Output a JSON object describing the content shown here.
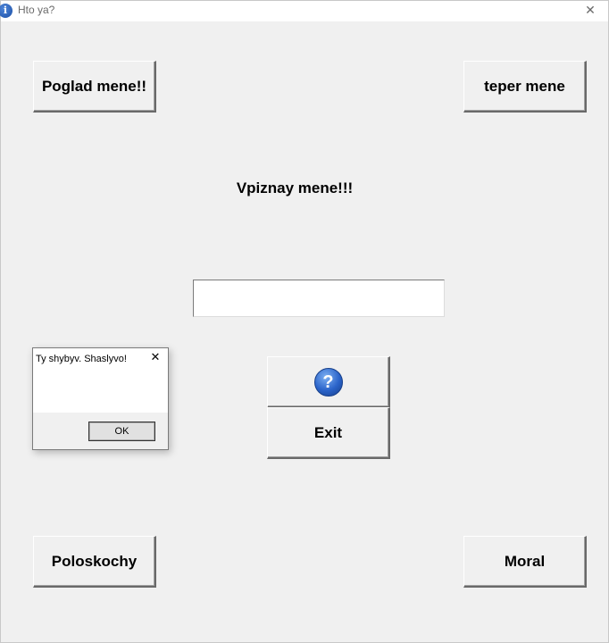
{
  "window": {
    "title": "Hto ya?",
    "title_icon": "info-icon",
    "close_glyph": "✕"
  },
  "buttons": {
    "top_left": "Poglad mene!!",
    "top_right": "teper mene",
    "exit": "Exit",
    "bottom_left": "Poloskochy",
    "bottom_right": "Moral",
    "help_icon": "question-icon",
    "help_glyph": "?"
  },
  "main": {
    "prompt_label": "Vpiznay mene!!!",
    "input_value": ""
  },
  "message_box": {
    "text": "Ty shybyv. Shaslyvo!",
    "ok_label": "OK",
    "close_glyph": "✕"
  }
}
